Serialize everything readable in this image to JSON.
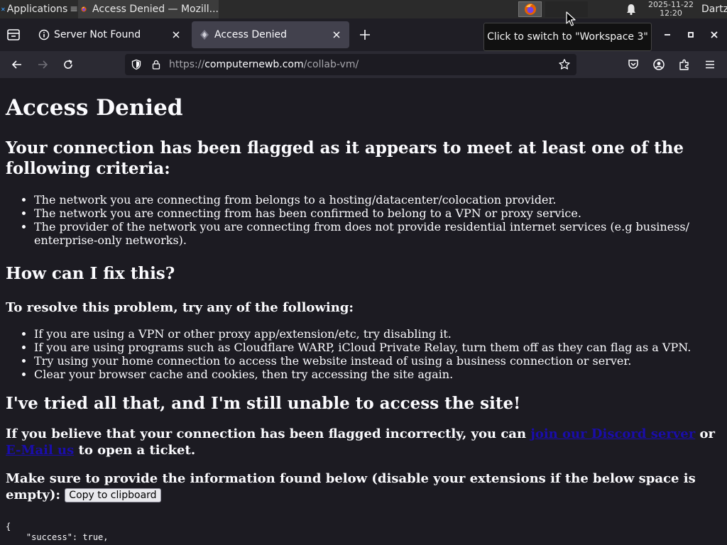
{
  "panel": {
    "apps_label": "Applications",
    "task_title": "Access Denied — Mozill...",
    "clock_date": "2025-11-22",
    "clock_time": "12:20",
    "user": "Dartz"
  },
  "tabs": [
    {
      "title": "Server Not Found",
      "active": false
    },
    {
      "title": "Access Denied",
      "active": true
    }
  ],
  "tooltip": "Click to switch to \"Workspace 3\"",
  "url": {
    "scheme": "https://",
    "host": "computernewb.com",
    "path": "/collab-vm/"
  },
  "page": {
    "title": "Access Denied",
    "criteria_heading": "Your connection has been flagged as it appears to meet at least one of the following criteria:",
    "criteria": [
      "The network you are connecting from belongs to a hosting/datacenter/colocation provider.",
      "The network you are connecting from has been confirmed to belong to a VPN or proxy service.",
      "The provider of the network you are connecting from does not provide residential internet services (e.g business/ enterprise-only networks)."
    ],
    "fix_heading": "How can I fix this?",
    "resolve_heading": "To resolve this problem, try any of the following:",
    "fixes": [
      "If you are using a VPN or other proxy app/extension/etc, try disabling it.",
      "If you are using programs such as Cloudflare WARP, iCloud Private Relay, turn them off as they can flag as a VPN.",
      "Try using your home connection to access the website instead of using a business connection or server.",
      "Clear your browser cache and cookies, then try accessing the site again."
    ],
    "tried_heading": "I've tried all that, and I'm still unable to access the site!",
    "believe_text_1": "If you believe that your connection has been flagged incorrectly, you can ",
    "discord_link": "join our Discord server",
    "or_text": " or ",
    "email_link": "E-Mail us",
    "believe_text_2": " to open a ticket.",
    "provide_text": "Make sure to provide the information found below (disable your extensions if the below space is empty): ",
    "copy_button": "Copy to clipboard",
    "json_text": "{\n    \"success\": true,"
  },
  "colors": {
    "page_bg": "#1c1b22",
    "link": "#1a0dab",
    "navbar_bg": "#2b2a33",
    "active_tab_bg": "#42414d"
  }
}
